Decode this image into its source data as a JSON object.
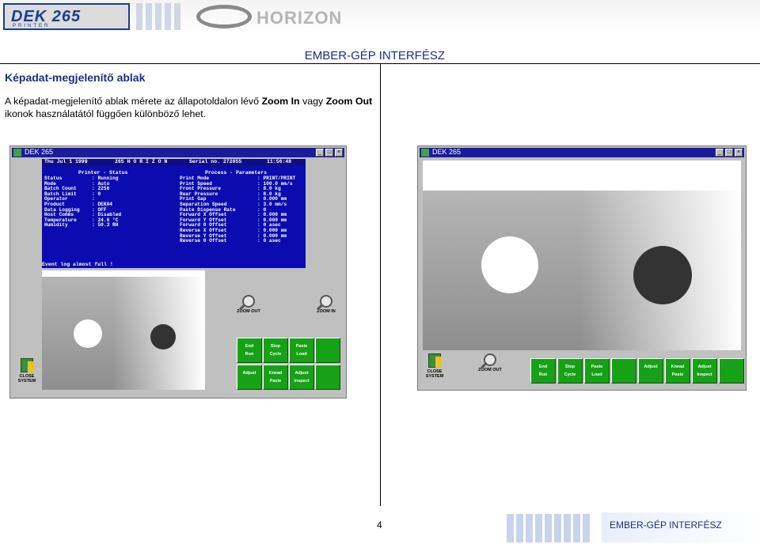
{
  "header": {
    "dek_logo": "DEK 265",
    "dek_sub": "PRINTER",
    "horizon_logo": "HORIZON",
    "doc_title": "EMBER-GÉP INTERFÉSZ"
  },
  "section": {
    "title": "Képadat-megjelenítő ablak",
    "para_part1": "A képadat-megjelenítő ablak mérete az állapotoldalon lévő ",
    "para_bold1": "Zoom In",
    "para_part2": " vagy ",
    "para_bold2": "Zoom Out",
    "para_part3": " ikonok használatától függően különböző lehet."
  },
  "left_window": {
    "title": "DEK 265",
    "info_bar": {
      "date": "Thu Jul  1 1999",
      "model": "265  H O R I Z O N",
      "serial": "Serial no. 272055",
      "time": "11:56:48"
    },
    "printer_status_heading": "Printer - Status",
    "status_rows": [
      {
        "key": "Status",
        "value": "Running"
      },
      {
        "key": "Mode",
        "value": "Auto"
      },
      {
        "key": "Batch Count",
        "value": "2256"
      },
      {
        "key": "Batch Limit",
        "value": "0"
      },
      {
        "key": "Operator",
        "value": ""
      },
      {
        "key": "Product",
        "value": "DEK04"
      },
      {
        "key": "Data Logging",
        "value": "OFF"
      },
      {
        "key": "Host Comms",
        "value": "Disabled"
      },
      {
        "key": "Temperature",
        "value": "24.6 °C"
      },
      {
        "key": "Humidity",
        "value": "50.3 RH"
      }
    ],
    "process_params_heading": "Process - Parameters",
    "param_rows": [
      {
        "key": "Print Mode",
        "value": "PRINT/PRINT"
      },
      {
        "key": "Print Speed",
        "value": "100.0 mm/s"
      },
      {
        "key": "Front Pressure",
        "value": "8.0 kg"
      },
      {
        "key": "Rear Pressure",
        "value": "8.0 kg"
      },
      {
        "key": "Print Gap",
        "value": "0.000 mm"
      },
      {
        "key": "Separation Speed",
        "value": "3.0 mm/s"
      },
      {
        "key": "Paste Dispense Rate",
        "value": "0"
      },
      {
        "key": "Forward X Offset",
        "value": "0.000 mm"
      },
      {
        "key": "Forward Y Offset",
        "value": "0.000 mm"
      },
      {
        "key": "Forward 0 Offset",
        "value": "0 asec"
      },
      {
        "key": "Reverse X Offset",
        "value": "0.000 mm"
      },
      {
        "key": "Reverse Y Offset",
        "value": "0.000 mm"
      },
      {
        "key": "Reverse 0 Offset",
        "value": "0 asec"
      }
    ],
    "event_log": "Event log almost full !",
    "zoom_out_label": "ZOOM OUT",
    "zoom_in_label": "ZOOM IN",
    "close_label": "CLOSE SYSTEM",
    "buttons_row1": [
      {
        "l1": "End",
        "l2": "Run"
      },
      {
        "l1": "Stop",
        "l2": "Cycle"
      },
      {
        "l1": "Paste",
        "l2": "Load"
      },
      {
        "l1": "",
        "l2": ""
      }
    ],
    "buttons_row2": [
      {
        "l1": "Adjust",
        "l2": ""
      },
      {
        "l1": "Knead",
        "l2": "Paste"
      },
      {
        "l1": "Adjust",
        "l2": "Inspect"
      },
      {
        "l1": "",
        "l2": ""
      }
    ]
  },
  "right_window": {
    "title": "DEK 265",
    "close_label": "CLOSE SYSTEM",
    "zoom_out_label": "ZOOM OUT",
    "buttons": [
      {
        "l1": "End",
        "l2": "Run"
      },
      {
        "l1": "Stop",
        "l2": "Cycle"
      },
      {
        "l1": "Paste",
        "l2": "Load"
      },
      {
        "l1": "",
        "l2": ""
      },
      {
        "l1": "Adjust",
        "l2": ""
      },
      {
        "l1": "Knead",
        "l2": "Paste"
      },
      {
        "l1": "Adjust",
        "l2": "Inspect"
      },
      {
        "l1": "",
        "l2": ""
      }
    ]
  },
  "footer": {
    "page_number": "4",
    "title": "EMBER-GÉP INTERFÉSZ"
  }
}
